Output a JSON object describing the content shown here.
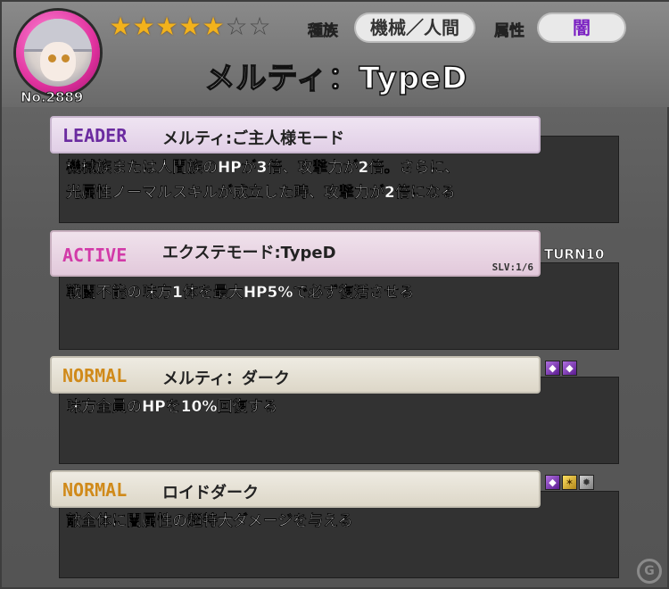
{
  "character": {
    "number": "No.2889",
    "name": "メルティ：TypeD",
    "rarity": 5,
    "rarity_max": 7,
    "tribe_label": "種族",
    "tribe_value": "機械／人間",
    "attribute_label": "属性",
    "attribute_value": "闇",
    "attribute_color": "#7a1fc2"
  },
  "skills": [
    {
      "kind": "LEADER",
      "kind_color": "#6b2ba0",
      "name": "メルティ:ご主人様モード",
      "description_lines": [
        "機械族または人間族のHPが3倍、攻撃力が2倍。さらに、",
        "光属性ノーマルスキルが成立した時、攻撃力が2倍になる"
      ]
    },
    {
      "kind": "ACTIVE",
      "kind_color": "#d23aa8",
      "name": "エクステモード:TypeD",
      "slv": "SLV:1/6",
      "turn": "TURN10",
      "description_lines": [
        "戦闘不能の味方1体を最大HP5%で必ず復活させる"
      ]
    },
    {
      "kind": "NORMAL",
      "kind_color": "#d08a1a",
      "name": "メルティ：ダーク",
      "orbs": [
        "dark-orb-icon",
        "dark-orb-icon"
      ],
      "description_lines": [
        "味方全員のHPを10%回復する"
      ]
    },
    {
      "kind": "NORMAL",
      "kind_color": "#d08a1a",
      "name": "ロイドダーク",
      "orbs": [
        "dark-orb-icon",
        "spark-orb-icon",
        "gear-orb-icon"
      ],
      "description_lines": [
        "敵全体に闇属性の超特大ダメージを与える"
      ]
    }
  ]
}
